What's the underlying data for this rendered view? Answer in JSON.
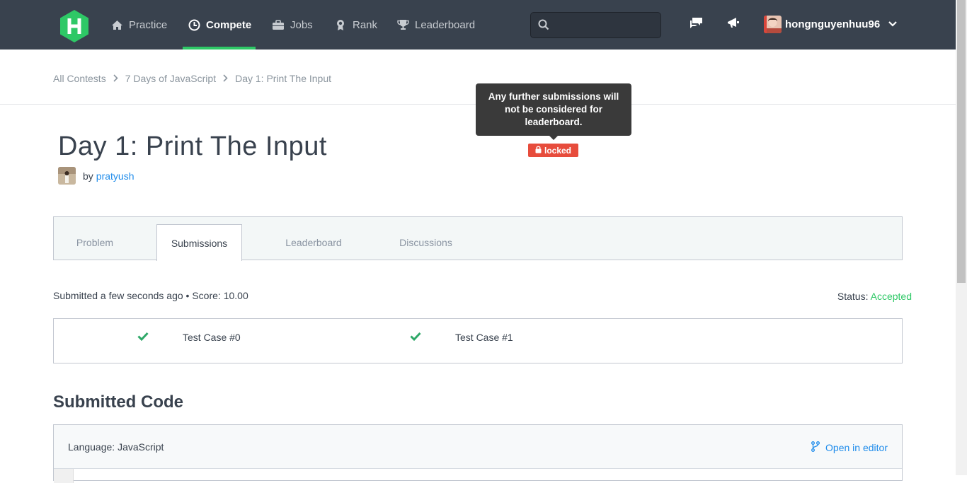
{
  "nav": {
    "items": [
      {
        "label": "Practice",
        "icon": "home-icon"
      },
      {
        "label": "Compete",
        "icon": "clock-icon",
        "active": true
      },
      {
        "label": "Jobs",
        "icon": "briefcase-icon"
      },
      {
        "label": "Rank",
        "icon": "medal-icon"
      },
      {
        "label": "Leaderboard",
        "icon": "trophy-icon"
      }
    ],
    "search_placeholder": "",
    "username": "hongnguyenhuu96"
  },
  "breadcrumb": [
    "All Contests",
    "7 Days of JavaScript",
    "Day 1: Print The Input"
  ],
  "tooltip": "Any further submissions will not be considered for leaderboard.",
  "locked_label": "locked",
  "challenge": {
    "title": "Day 1: Print The Input",
    "by_label": "by",
    "author": "pratyush"
  },
  "tabs": [
    "Problem",
    "Submissions",
    "Leaderboard",
    "Discussions"
  ],
  "submission": {
    "summary": "Submitted a few seconds ago • Score: 10.00",
    "status_label": "Status:",
    "status_value": "Accepted"
  },
  "test_cases": [
    "Test Case #0",
    "Test Case #1"
  ],
  "code": {
    "heading": "Submitted Code",
    "language": "Language: JavaScript",
    "open_editor": "Open in editor"
  },
  "colors": {
    "nav_bg": "#39424e",
    "accent": "#2ec866",
    "link": "#1f8ceb",
    "locked": "#e74c3c"
  }
}
